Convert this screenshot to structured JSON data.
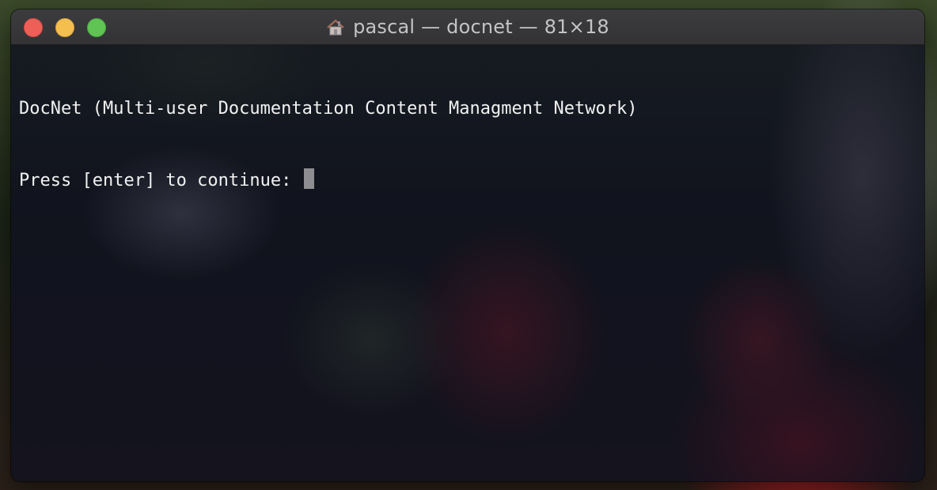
{
  "window": {
    "title": "pascal — docnet — 81×18",
    "title_icon": "home-icon"
  },
  "traffic_lights": {
    "close_color": "#ee5f58",
    "minimize_color": "#f5bf4f",
    "zoom_color": "#5fc454"
  },
  "terminal": {
    "lines": [
      "DocNet (Multi-user Documentation Content Managment Network)",
      "Press [enter] to continue: "
    ],
    "text_color": "#f2f2f2",
    "cursor_color": "#8e8e92"
  }
}
